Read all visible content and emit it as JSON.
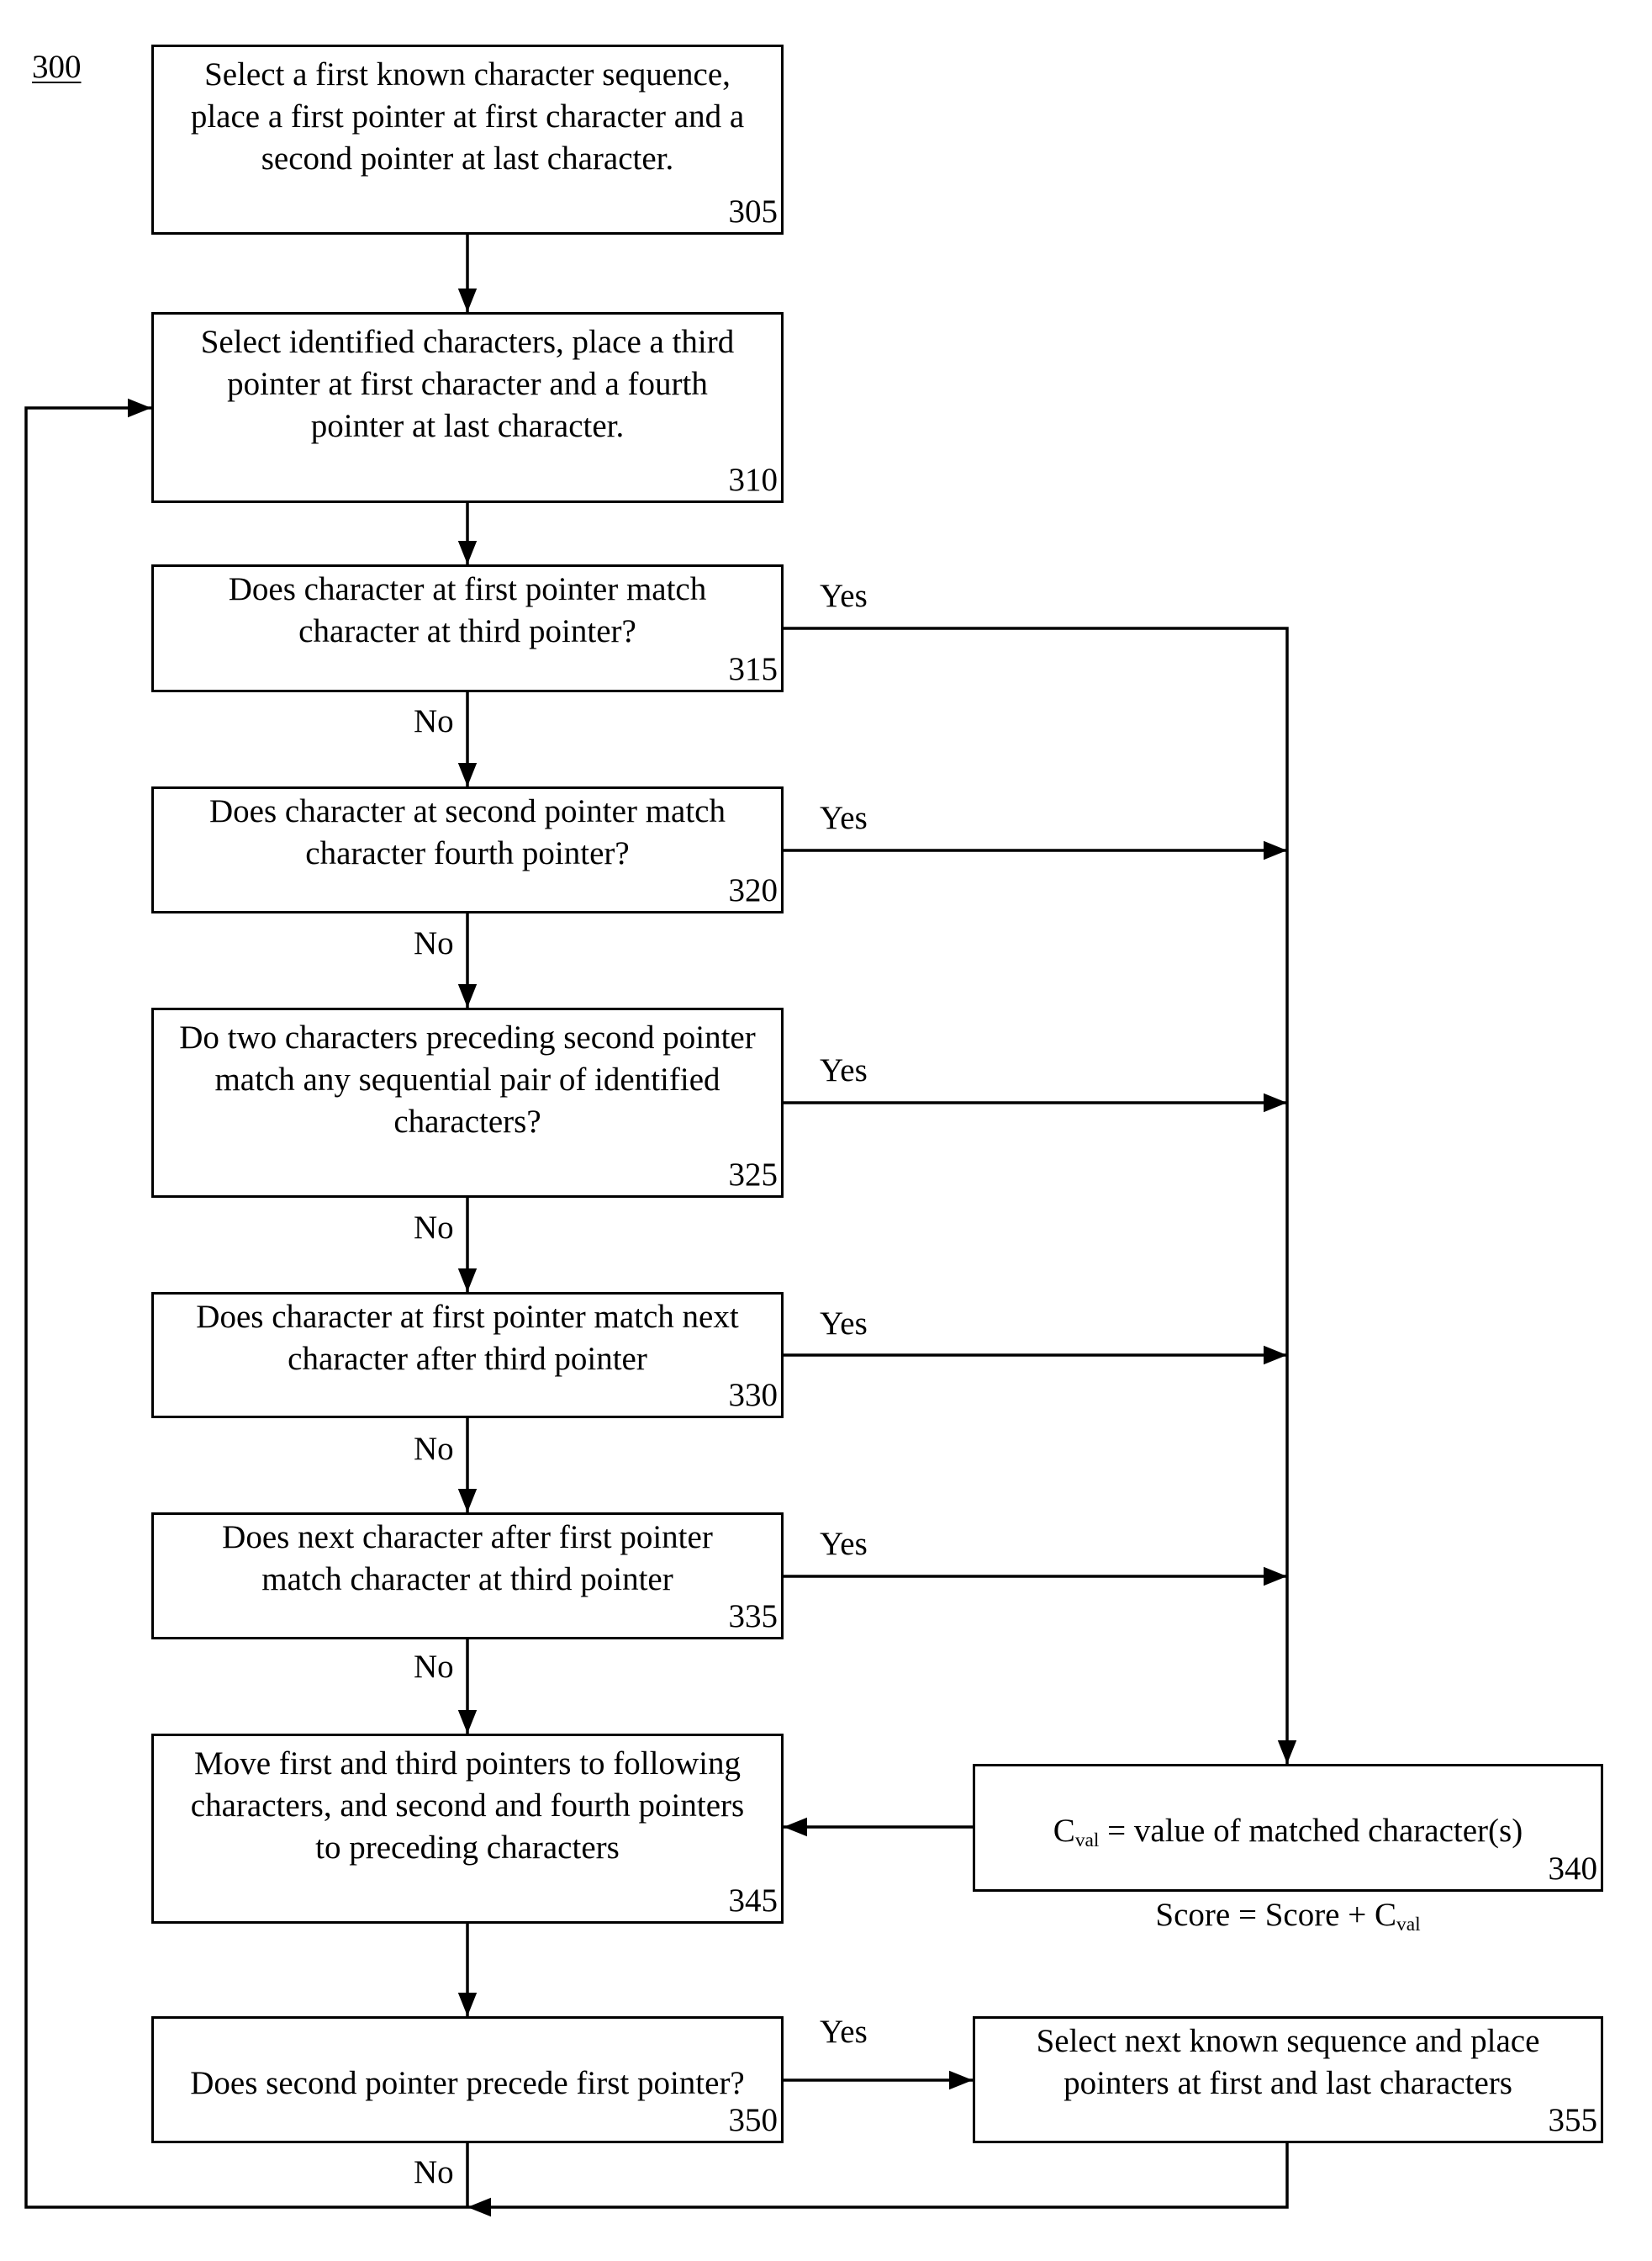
{
  "figure": {
    "label": "300"
  },
  "nodes": {
    "n305": {
      "ref": "305",
      "text": "Select a first known character sequence,\nplace a first pointer at first character and a\nsecond pointer at last character."
    },
    "n310": {
      "ref": "310",
      "text": "Select identified characters, place a third\npointer at first character and a fourth\npointer at last character."
    },
    "n315": {
      "ref": "315",
      "text": "Does character at first pointer match\ncharacter at third pointer?"
    },
    "n320": {
      "ref": "320",
      "text": "Does character at second pointer match\ncharacter fourth pointer?"
    },
    "n325": {
      "ref": "325",
      "text": "Do two characters preceding second pointer\nmatch any sequential pair of identified\ncharacters?"
    },
    "n330": {
      "ref": "330",
      "text": "Does character at first pointer match next\ncharacter after third pointer"
    },
    "n335": {
      "ref": "335",
      "text": "Does next character after first pointer\nmatch character at third pointer"
    },
    "n340": {
      "ref": "340",
      "line1_prefix": "C",
      "line1_sub": "val",
      "line1_suffix": " = value of matched character(s)",
      "line2_prefix": "Score = Score + C",
      "line2_sub": "val"
    },
    "n345": {
      "ref": "345",
      "text": "Move first and third pointers to following\ncharacters, and second and fourth pointers\nto preceding characters"
    },
    "n350": {
      "ref": "350",
      "text": "Does second pointer precede first pointer?"
    },
    "n355": {
      "ref": "355",
      "text": "Select next known sequence and place\npointers at first and last characters"
    }
  },
  "edge_labels": {
    "yes": "Yes",
    "no": "No"
  },
  "edges": [
    {
      "from": "305",
      "to": "310",
      "label": ""
    },
    {
      "from": "310",
      "to": "315",
      "label": ""
    },
    {
      "from": "315",
      "to": "340",
      "label": "Yes"
    },
    {
      "from": "315",
      "to": "320",
      "label": "No"
    },
    {
      "from": "320",
      "to": "340",
      "label": "Yes"
    },
    {
      "from": "320",
      "to": "325",
      "label": "No"
    },
    {
      "from": "325",
      "to": "340",
      "label": "Yes"
    },
    {
      "from": "325",
      "to": "330",
      "label": "No"
    },
    {
      "from": "330",
      "to": "340",
      "label": "Yes"
    },
    {
      "from": "330",
      "to": "335",
      "label": "No"
    },
    {
      "from": "335",
      "to": "340",
      "label": "Yes"
    },
    {
      "from": "335",
      "to": "345",
      "label": "No"
    },
    {
      "from": "340",
      "to": "345",
      "label": ""
    },
    {
      "from": "345",
      "to": "350",
      "label": ""
    },
    {
      "from": "350",
      "to": "355",
      "label": "Yes"
    },
    {
      "from": "350",
      "to": "310",
      "label": "No"
    },
    {
      "from": "355",
      "to": "310",
      "label": ""
    }
  ],
  "colors": {
    "stroke": "#000000",
    "background": "#ffffff"
  }
}
